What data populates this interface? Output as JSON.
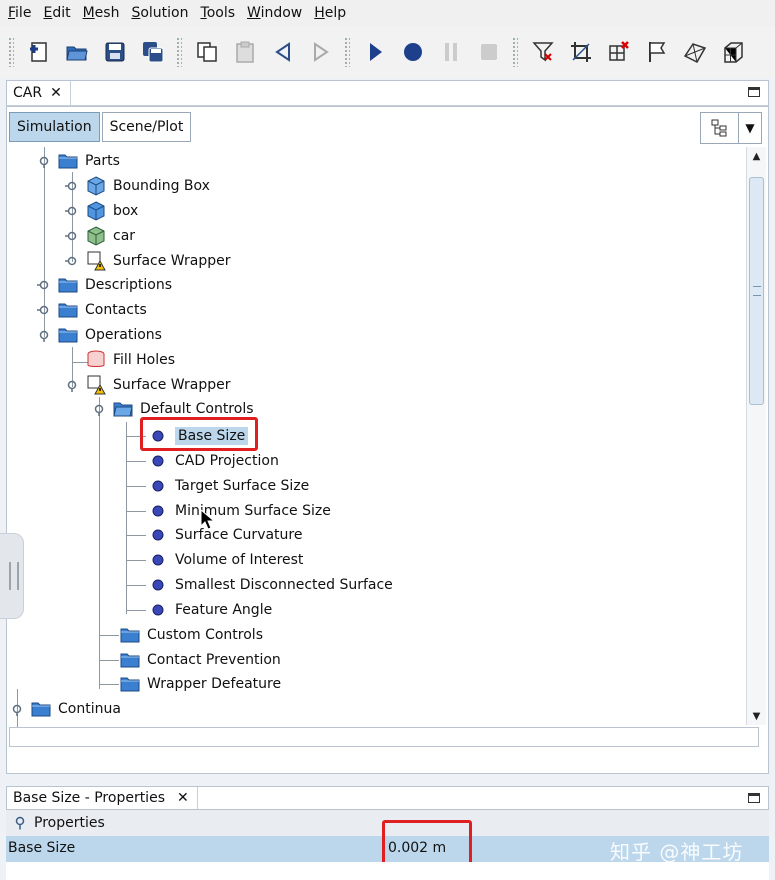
{
  "menu": [
    {
      "mnemonic": "F",
      "rest": "ile"
    },
    {
      "mnemonic": "E",
      "rest": "dit"
    },
    {
      "mnemonic": "M",
      "rest": "esh"
    },
    {
      "mnemonic": "S",
      "rest": "olution"
    },
    {
      "mnemonic": "T",
      "rest": "ools"
    },
    {
      "mnemonic": "W",
      "rest": "indow"
    },
    {
      "mnemonic": "H",
      "rest": "elp"
    }
  ],
  "toolbar": {
    "icons": [
      "new-sim-icon",
      "open-icon",
      "save-icon",
      "save-all-icon",
      "copy-icon",
      "clipboard-icon",
      "step-back-icon",
      "step-forward-icon",
      "run-icon",
      "record-icon",
      "pause-icon",
      "stop-icon",
      "filter-icon",
      "crop-icon",
      "grid-delete-icon",
      "flag-icon",
      "mesh-icon",
      "volume-grid-icon"
    ]
  },
  "editor": {
    "tab_label": "CAR",
    "close_glyph": "✕"
  },
  "panel": {
    "tabs": [
      {
        "label": "Simulation",
        "active": true
      },
      {
        "label": "Scene/Plot",
        "active": false
      }
    ]
  },
  "tree": {
    "nodes": [
      {
        "label": "Parts",
        "icon": "folder"
      },
      {
        "label": "Bounding Box",
        "icon": "part-cube"
      },
      {
        "label": "box",
        "icon": "part-cube"
      },
      {
        "label": "car",
        "icon": "part-car"
      },
      {
        "label": "Surface Wrapper",
        "icon": "wrapper-warning"
      },
      {
        "label": "Descriptions",
        "icon": "folder"
      },
      {
        "label": "Contacts",
        "icon": "folder"
      },
      {
        "label": "Operations",
        "icon": "folder"
      },
      {
        "label": "Fill Holes",
        "icon": "fill-holes"
      },
      {
        "label": "Surface Wrapper",
        "icon": "wrapper-warning"
      },
      {
        "label": "Default Controls",
        "icon": "folder"
      },
      {
        "label": "Base Size",
        "icon": "dot",
        "selected": true
      },
      {
        "label": "CAD Projection",
        "icon": "dot"
      },
      {
        "label": "Target Surface Size",
        "icon": "dot"
      },
      {
        "label": "Minimum Surface Size",
        "icon": "dot"
      },
      {
        "label": "Surface Curvature",
        "icon": "dot"
      },
      {
        "label": "Volume of Interest",
        "icon": "dot"
      },
      {
        "label": "Smallest Disconnected Surface",
        "icon": "dot"
      },
      {
        "label": "Feature Angle",
        "icon": "dot"
      },
      {
        "label": "Custom Controls",
        "icon": "folder"
      },
      {
        "label": "Contact Prevention",
        "icon": "folder"
      },
      {
        "label": "Wrapper Defeature",
        "icon": "folder"
      },
      {
        "label": "Continua",
        "icon": "folder"
      }
    ]
  },
  "properties": {
    "tab_label": "Base Size - Properties",
    "close_glyph": "✕",
    "section_label": "Properties",
    "row_name": "Base Size",
    "row_value": "0.002 m"
  },
  "watermark": "知乎 @神工坊",
  "colors": {
    "selection": "#bcd7ec",
    "highlight_box": "#e02020",
    "folder_blue": "#3b7fd0",
    "dot_blue": "#3a47b8"
  }
}
